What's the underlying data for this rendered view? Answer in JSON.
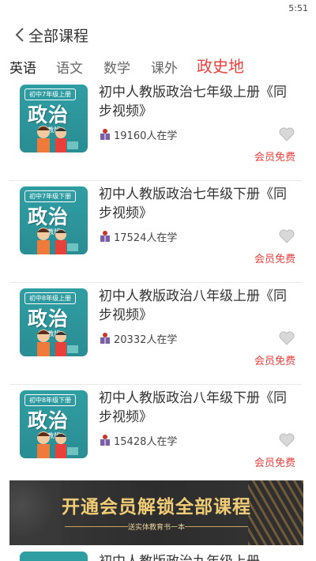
{
  "status": {
    "time": "5:51"
  },
  "header": {
    "back_icon": "chevron-left-icon",
    "title": "全部课程"
  },
  "tabs": [
    {
      "label": "英语"
    },
    {
      "label": "语文"
    },
    {
      "label": "数学"
    },
    {
      "label": "课外"
    },
    {
      "label": "政史地",
      "active": true
    }
  ],
  "courses": [
    {
      "cover": {
        "grade": "初中7年级上册",
        "subject": "政治",
        "edition": "(人教版)"
      },
      "title": "初中人教版政治七年级上册《同步视频》",
      "learners": "19160人在学",
      "badge": "会员免费"
    },
    {
      "cover": {
        "grade": "初中7年级下册",
        "subject": "政治",
        "edition": "(人教版)"
      },
      "title": "初中人教版政治七年级下册《同步视频》",
      "learners": "17524人在学",
      "badge": "会员免费"
    },
    {
      "cover": {
        "grade": "初中8年级上册",
        "subject": "政治",
        "edition": "(人教版)"
      },
      "title": "初中人教版政治八年级上册《同步视频》",
      "learners": "20332人在学",
      "badge": "会员免费"
    },
    {
      "cover": {
        "grade": "初中8年级下册",
        "subject": "政治",
        "edition": "(人教版)"
      },
      "title": "初中人教版政治八年级下册《同步视频》",
      "learners": "15428人在学",
      "badge": "会员免费"
    }
  ],
  "banner": {
    "headline": "开通会员解锁全部课程",
    "sub": "送实体教育书一本"
  },
  "peek": {
    "title": "初中人教版政治九年级上册"
  },
  "colors": {
    "accent": "#e8413c",
    "cover": "#2f9ea3",
    "banner_gold": "#f1cc76"
  }
}
